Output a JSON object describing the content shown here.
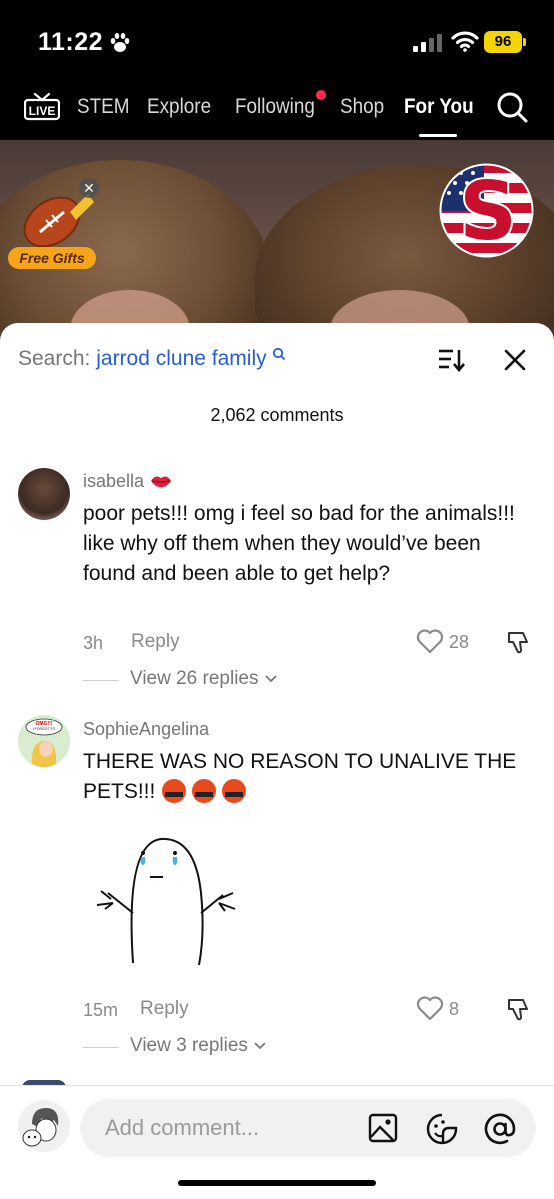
{
  "status_bar": {
    "time": "11:22",
    "battery": "96"
  },
  "nav": {
    "items": [
      "STEM",
      "Explore",
      "Following",
      "Shop",
      "For You"
    ],
    "active": "For You",
    "live_label": "LIVE"
  },
  "video": {
    "free_gifts_label": "Free Gifts"
  },
  "sheet": {
    "search_prefix": "Search:",
    "search_query": "jarrod clune family",
    "comment_count": "2,062 comments"
  },
  "comments": [
    {
      "username": "isabella",
      "text": "poor pets!!! omg i feel so bad for the animals!!! like why off them when they would’ve been found and been able to get help?",
      "time": "3h",
      "reply_label": "Reply",
      "likes": "28",
      "view_replies": "View 26 replies"
    },
    {
      "username": "SophieAngelina",
      "text": "THERE WAS NO REASON TO UNALIVE THE PETS!!!",
      "time": "15m",
      "reply_label": "Reply",
      "likes": "8",
      "view_replies": "View 3 replies",
      "avatar_text": "OMG!!! I FORGOT TO HAVE CHILDREN!"
    }
  ],
  "composer": {
    "placeholder": "Add comment..."
  },
  "colors": {
    "accent_red": "#fe2c55",
    "link_blue": "#2a5bd7",
    "battery_yellow": "#f5d400"
  }
}
